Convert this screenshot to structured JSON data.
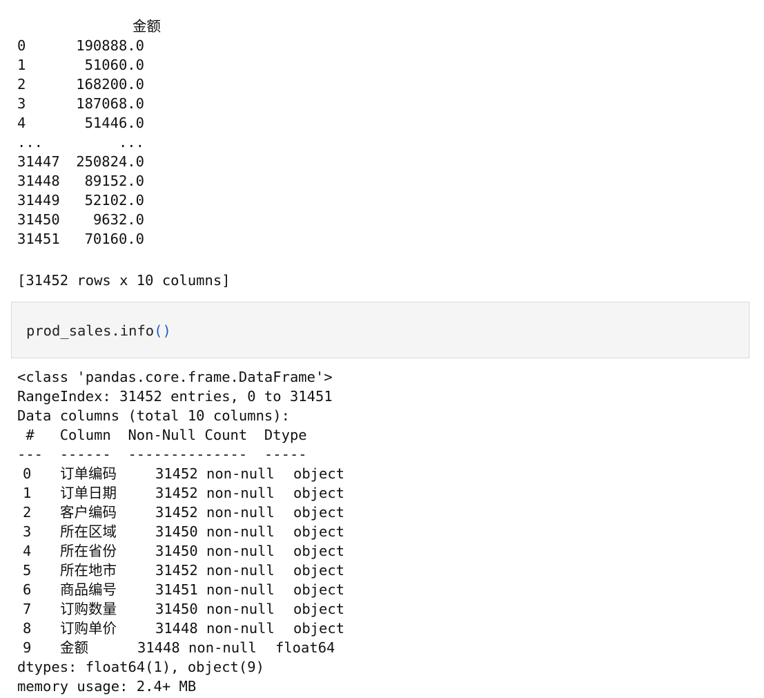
{
  "series_output": {
    "header": "金额",
    "rows": [
      {
        "index": "0",
        "value": "190888.0"
      },
      {
        "index": "1",
        "value": "51060.0"
      },
      {
        "index": "2",
        "value": "168200.0"
      },
      {
        "index": "3",
        "value": "187068.0"
      },
      {
        "index": "4",
        "value": "51446.0"
      },
      {
        "index": "...",
        "value": "..."
      },
      {
        "index": "31447",
        "value": "250824.0"
      },
      {
        "index": "31448",
        "value": "89152.0"
      },
      {
        "index": "31449",
        "value": "52102.0"
      },
      {
        "index": "31450",
        "value": "9632.0"
      },
      {
        "index": "31451",
        "value": "70160.0"
      }
    ],
    "summary": "[31452 rows x 10 columns]"
  },
  "code_cell": {
    "code_prefix": "prod_sales.info",
    "code_parens": "()"
  },
  "info_output": {
    "class_line": "<class 'pandas.core.frame.DataFrame'>",
    "range_line": "RangeIndex: 31452 entries, 0 to 31451",
    "data_columns_line": "Data columns (total 10 columns):",
    "header_line": " #   Column  Non-Null Count  Dtype  ",
    "separator_line": "---  ------  --------------  -----  ",
    "columns": [
      {
        "num": "0",
        "name": "订单编码",
        "count": "31452 non-null",
        "dtype": "object"
      },
      {
        "num": "1",
        "name": "订单日期",
        "count": "31452 non-null",
        "dtype": "object"
      },
      {
        "num": "2",
        "name": "客户编码",
        "count": "31452 non-null",
        "dtype": "object"
      },
      {
        "num": "3",
        "name": "所在区域",
        "count": "31450 non-null",
        "dtype": "object"
      },
      {
        "num": "4",
        "name": "所在省份",
        "count": "31450 non-null",
        "dtype": "object"
      },
      {
        "num": "5",
        "name": "所在地市",
        "count": "31452 non-null",
        "dtype": "object"
      },
      {
        "num": "6",
        "name": "商品编号",
        "count": "31451 non-null",
        "dtype": "object"
      },
      {
        "num": "7",
        "name": "订购数量",
        "count": "31450 non-null",
        "dtype": "object"
      },
      {
        "num": "8",
        "name": "订购单价",
        "count": "31448 non-null",
        "dtype": "object"
      },
      {
        "num": "9",
        "name": "金额",
        "count": "31448 non-null",
        "dtype": "float64"
      }
    ],
    "dtypes_line": "dtypes: float64(1), object(9)",
    "memory_line": "memory usage: 2.4+ MB"
  }
}
